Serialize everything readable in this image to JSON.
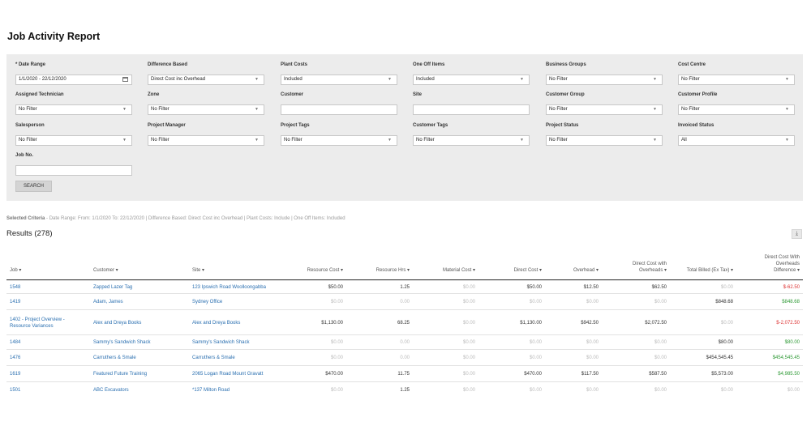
{
  "page": {
    "title": "Job Activity Report"
  },
  "filters": [
    {
      "label": "* Date Range",
      "value": "1/1/2020 - 22/12/2020",
      "kind": "date"
    },
    {
      "label": "Difference Based",
      "value": "Direct Cost inc Overhead",
      "kind": "select"
    },
    {
      "label": "Plant Costs",
      "value": "Included",
      "kind": "select"
    },
    {
      "label": "One Off Items",
      "value": "Included",
      "kind": "select"
    },
    {
      "label": "Business Groups",
      "value": "No Filter",
      "kind": "select"
    },
    {
      "label": "Cost Centre",
      "value": "No Filter",
      "kind": "select"
    },
    {
      "label": "Assigned Technician",
      "value": "No Filter",
      "kind": "select"
    },
    {
      "label": "Zone",
      "value": "No Filter",
      "kind": "select"
    },
    {
      "label": "Customer",
      "value": "",
      "kind": "text"
    },
    {
      "label": "Site",
      "value": "",
      "kind": "text"
    },
    {
      "label": "Customer Group",
      "value": "No Filter",
      "kind": "select"
    },
    {
      "label": "Customer Profile",
      "value": "No Filter",
      "kind": "select"
    },
    {
      "label": "Salesperson",
      "value": "No Filter",
      "kind": "select"
    },
    {
      "label": "Project Manager",
      "value": "No Filter",
      "kind": "select"
    },
    {
      "label": "Project Tags",
      "value": "No Filter",
      "kind": "select"
    },
    {
      "label": "Customer Tags",
      "value": "No Filter",
      "kind": "select"
    },
    {
      "label": "Project Status",
      "value": "No Filter",
      "kind": "select"
    },
    {
      "label": "Invoiced Status",
      "value": "All",
      "kind": "select"
    },
    {
      "label": "Job No.",
      "value": "",
      "kind": "text"
    }
  ],
  "search_label": "SEARCH",
  "criteria": {
    "label": "Selected Criteria",
    "text": " - Date Range: From: 1/1/2020 To: 22/12/2020 | Difference Based: Direct Cost inc Overhead | Plant Costs: Include | One Off Items: Included"
  },
  "results": {
    "title": "Results (278)",
    "download_glyph": "⤓"
  },
  "table": {
    "columns": [
      {
        "label": "Job ▾"
      },
      {
        "label": "Customer ▾"
      },
      {
        "label": "Site ▾"
      },
      {
        "label": "Resource Cost ▾"
      },
      {
        "label": "Resource Hrs ▾"
      },
      {
        "label": "Material Cost ▾"
      },
      {
        "label": "Direct Cost ▾"
      },
      {
        "label": "Overhead ▾"
      },
      {
        "label": "Direct Cost with\nOverheads ▾"
      },
      {
        "label": "Total Billed (Ex Tax) ▾"
      },
      {
        "label": "Direct Cost With\nOverheads\nDifference ▾"
      }
    ],
    "rows": [
      {
        "job": "1548",
        "customer": "Zapped Lazer Tag",
        "site": "123 Ipswich Road Woolloongabba",
        "resource_cost": "$50.00",
        "resource_hrs": "1.25",
        "material_cost": "$0.00",
        "direct_cost": "$50.00",
        "overhead": "$12.50",
        "dc_with_oh": "$62.50",
        "total_billed": "$0.00",
        "difference": "$-62.50"
      },
      {
        "job": "1419",
        "customer": "Adam, James",
        "site": "Sydney Office",
        "resource_cost": "$0.00",
        "resource_hrs": "0.00",
        "material_cost": "$0.00",
        "direct_cost": "$0.00",
        "overhead": "$0.00",
        "dc_with_oh": "$0.00",
        "total_billed": "$848.68",
        "difference": "$848.68"
      },
      {
        "job": "1402 - Project Overview -\nResource Variances",
        "customer": "Alex and Dreya Books",
        "site": "Alex and Dreya Books",
        "resource_cost": "$1,130.00",
        "resource_hrs": "68.25",
        "material_cost": "$0.00",
        "direct_cost": "$1,130.00",
        "overhead": "$942.50",
        "dc_with_oh": "$2,072.50",
        "total_billed": "$0.00",
        "difference": "$-2,072.50"
      },
      {
        "job": "1484",
        "customer": "Sammy's Sandwich Shack",
        "site": "Sammy's Sandwich Shack",
        "resource_cost": "$0.00",
        "resource_hrs": "0.00",
        "material_cost": "$0.00",
        "direct_cost": "$0.00",
        "overhead": "$0.00",
        "dc_with_oh": "$0.00",
        "total_billed": "$80.00",
        "difference": "$80.00"
      },
      {
        "job": "1476",
        "customer": "Carruthers & Smale",
        "site": "Carruthers & Smale",
        "resource_cost": "$0.00",
        "resource_hrs": "0.00",
        "material_cost": "$0.00",
        "direct_cost": "$0.00",
        "overhead": "$0.00",
        "dc_with_oh": "$0.00",
        "total_billed": "$454,545.45",
        "difference": "$454,545.45"
      },
      {
        "job": "1619",
        "customer": "Featured Future Training",
        "site": "2065 Logan Road Mount Gravatt",
        "resource_cost": "$470.00",
        "resource_hrs": "11.75",
        "material_cost": "$0.00",
        "direct_cost": "$470.00",
        "overhead": "$117.50",
        "dc_with_oh": "$587.50",
        "total_billed": "$5,573.00",
        "difference": "$4,985.50"
      },
      {
        "job": "1501",
        "customer": "ABC Excavators",
        "site": "*137 Milton Road",
        "resource_cost": "$0.00",
        "resource_hrs": "1.25",
        "material_cost": "$0.00",
        "direct_cost": "$0.00",
        "overhead": "$0.00",
        "dc_with_oh": "$0.00",
        "total_billed": "$0.00",
        "difference": "$0.00"
      }
    ]
  }
}
